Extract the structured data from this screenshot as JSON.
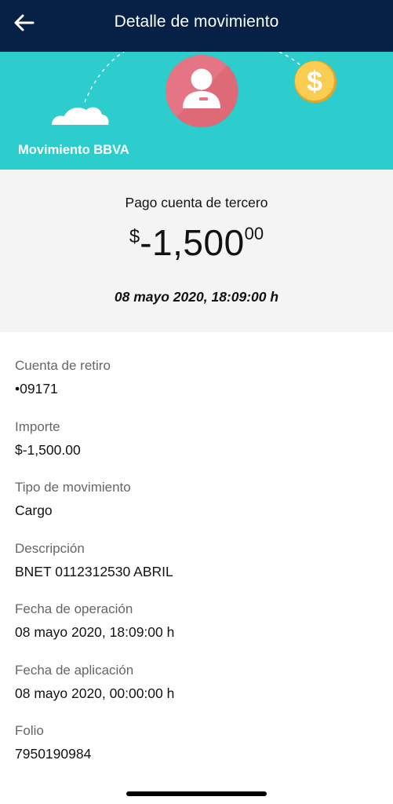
{
  "header": {
    "title": "Detalle de movimiento",
    "back_icon": "arrow-left-icon"
  },
  "banner": {
    "label": "Movimiento BBVA",
    "bg_color": "#2dcccd",
    "icons": [
      "cloud-icon",
      "user-icon",
      "dollar-coin-icon"
    ]
  },
  "summary": {
    "title": "Pago cuenta de tercero",
    "amount_currency": "$",
    "amount_integer": "-1,500",
    "amount_decimals": "00",
    "date": "08 mayo 2020, 18:09:00 h"
  },
  "details": [
    {
      "label": "Cuenta de retiro",
      "value": "•09171"
    },
    {
      "label": "Importe",
      "value": "$-1,500.00"
    },
    {
      "label": "Tipo de movimiento",
      "value": "Cargo"
    },
    {
      "label": "Descripción",
      "value": "BNET 0112312530 ABRIL"
    },
    {
      "label": "Fecha de operación",
      "value": "08 mayo 2020, 18:09:00 h"
    },
    {
      "label": "Fecha de aplicación",
      "value": "08 mayo 2020, 00:00:00 h"
    },
    {
      "label": "Folio",
      "value": "7950190984"
    }
  ],
  "colors": {
    "navbar": "#072146",
    "accent_teal": "#2dcccd",
    "avatar_pink": "#e57584",
    "coin_gold": "#f8cd51"
  }
}
